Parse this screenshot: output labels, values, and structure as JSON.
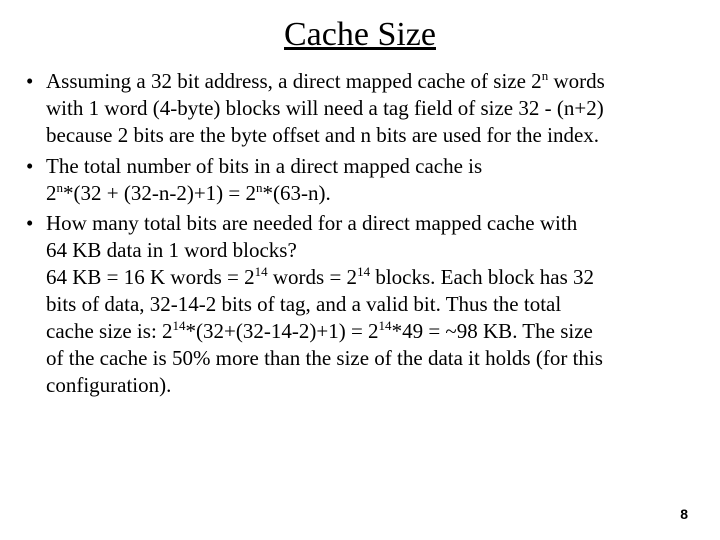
{
  "slide": {
    "title": "Cache Size",
    "bullets": [
      {
        "lines": [
          {
            "pre": "Assuming a 32 bit address, a direct mapped cache of size 2",
            "sup": "n",
            "post": " words"
          },
          {
            "pre": "with 1 word (4-byte) blocks will need a tag field of size 32 - (n+2)"
          },
          {
            "pre": "because 2 bits are the byte offset and n bits are used for the index."
          }
        ]
      },
      {
        "lines": [
          {
            "pre": "The total number of bits in a direct mapped cache is"
          },
          {
            "pre": "2",
            "sup": "n",
            "post": "*(32 + (32-n-2)+1) = 2",
            "sup2": "n",
            "post2": "*(63-n)."
          }
        ]
      },
      {
        "lines": [
          {
            "pre": "How many total bits are needed for a direct mapped cache with"
          },
          {
            "pre": "64 KB data in 1 word blocks?"
          },
          {
            "pre": "64 KB = 16 K words = 2",
            "sup": "14",
            "post": " words = 2",
            "sup2": "14",
            "post2": " blocks. Each block has 32"
          },
          {
            "pre": "bits of data, 32-14-2 bits of tag, and a valid bit. Thus the total"
          },
          {
            "pre": "cache size is: 2",
            "sup": "14",
            "post": "*(32+(32-14-2)+1) = 2",
            "sup2": "14",
            "post2": "*49 = ~98 KB. The size"
          },
          {
            "pre": "of the cache is 50% more than the size of the data it holds (for this"
          },
          {
            "pre": "configuration)."
          }
        ]
      }
    ],
    "page_number": "8"
  }
}
